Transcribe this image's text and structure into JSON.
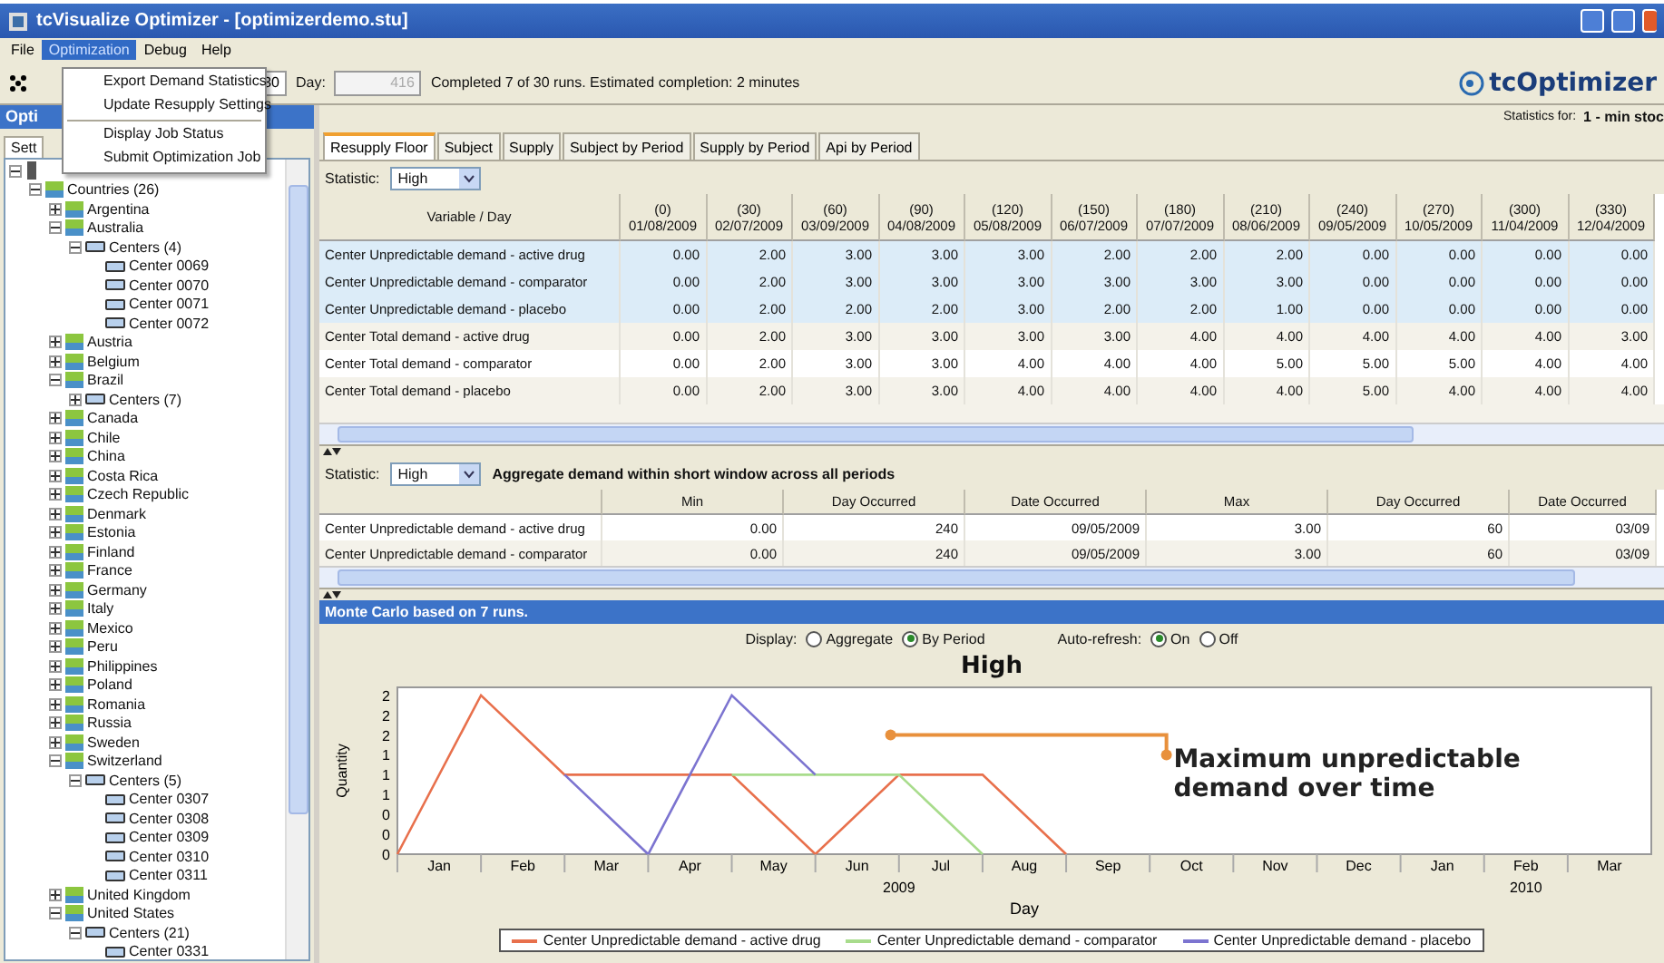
{
  "window": {
    "title": "tcVisualize Optimizer - [optimizerdemo.stu]"
  },
  "menu": [
    {
      "label": "File",
      "selected": false
    },
    {
      "label": "Optimization",
      "selected": true
    },
    {
      "label": "Debug",
      "selected": false
    },
    {
      "label": "Help",
      "selected": false
    }
  ],
  "open_menu": {
    "groups": [
      [
        "Export Demand Statistics",
        "Update Resupply Settings"
      ],
      [
        "Display Job Status",
        "Submit Optimization Job"
      ]
    ]
  },
  "toolbar": {
    "runs": "30",
    "day_label": "Day:",
    "day": "416",
    "day_disabled": true,
    "status": "Completed 7 of 30 runs.  Estimated completion: 2 minutes",
    "logo": "tcOptimizer"
  },
  "left_panel": {
    "title": "Opti",
    "tab": "Sett",
    "tree": [
      {
        "label": "Countries (26)",
        "kind": "group",
        "expanded": true,
        "children": [
          {
            "label": "Argentina",
            "kind": "country",
            "expanded": false
          },
          {
            "label": "Australia",
            "kind": "country",
            "expanded": true,
            "children": [
              {
                "label": "Centers (4)",
                "kind": "centers",
                "expanded": true,
                "children": [
                  {
                    "label": "Center 0069",
                    "kind": "center"
                  },
                  {
                    "label": "Center 0070",
                    "kind": "center"
                  },
                  {
                    "label": "Center 0071",
                    "kind": "center"
                  },
                  {
                    "label": "Center 0072",
                    "kind": "center"
                  }
                ]
              }
            ]
          },
          {
            "label": "Austria",
            "kind": "country",
            "expanded": false
          },
          {
            "label": "Belgium",
            "kind": "country",
            "expanded": false
          },
          {
            "label": "Brazil",
            "kind": "country",
            "expanded": true,
            "children": [
              {
                "label": "Centers (7)",
                "kind": "centers",
                "expanded": false
              }
            ]
          },
          {
            "label": "Canada",
            "kind": "country",
            "expanded": false
          },
          {
            "label": "Chile",
            "kind": "country",
            "expanded": false
          },
          {
            "label": "China",
            "kind": "country",
            "expanded": false
          },
          {
            "label": "Costa Rica",
            "kind": "country",
            "expanded": false
          },
          {
            "label": "Czech Republic",
            "kind": "country",
            "expanded": false
          },
          {
            "label": "Denmark",
            "kind": "country",
            "expanded": false
          },
          {
            "label": "Estonia",
            "kind": "country",
            "expanded": false
          },
          {
            "label": "Finland",
            "kind": "country",
            "expanded": false
          },
          {
            "label": "France",
            "kind": "country",
            "expanded": false
          },
          {
            "label": "Germany",
            "kind": "country",
            "expanded": false
          },
          {
            "label": "Italy",
            "kind": "country",
            "expanded": false
          },
          {
            "label": "Mexico",
            "kind": "country",
            "expanded": false
          },
          {
            "label": "Peru",
            "kind": "country",
            "expanded": false
          },
          {
            "label": "Philippines",
            "kind": "country",
            "expanded": false
          },
          {
            "label": "Poland",
            "kind": "country",
            "expanded": false
          },
          {
            "label": "Romania",
            "kind": "country",
            "expanded": false
          },
          {
            "label": "Russia",
            "kind": "country",
            "expanded": false
          },
          {
            "label": "Sweden",
            "kind": "country",
            "expanded": false
          },
          {
            "label": "Switzerland",
            "kind": "country",
            "expanded": true,
            "children": [
              {
                "label": "Centers (5)",
                "kind": "centers",
                "expanded": true,
                "children": [
                  {
                    "label": "Center 0307",
                    "kind": "center"
                  },
                  {
                    "label": "Center 0308",
                    "kind": "center"
                  },
                  {
                    "label": "Center 0309",
                    "kind": "center"
                  },
                  {
                    "label": "Center 0310",
                    "kind": "center"
                  },
                  {
                    "label": "Center 0311",
                    "kind": "center"
                  }
                ]
              }
            ]
          },
          {
            "label": "United Kingdom",
            "kind": "country",
            "expanded": false
          },
          {
            "label": "United States",
            "kind": "country",
            "expanded": true,
            "children": [
              {
                "label": "Centers (21)",
                "kind": "centers",
                "expanded": true,
                "children": [
                  {
                    "label": "Center 0331",
                    "kind": "center"
                  }
                ]
              }
            ]
          }
        ]
      }
    ]
  },
  "statistics_for": {
    "label": "Statistics for:",
    "value": "1 - min stoc"
  },
  "tabs": [
    {
      "label": "Resupply Floor",
      "selected": true
    },
    {
      "label": "Subject",
      "selected": false
    },
    {
      "label": "Supply",
      "selected": false
    },
    {
      "label": "Subject by Period",
      "selected": false
    },
    {
      "label": "Supply by Period",
      "selected": false
    },
    {
      "label": "Api by Period",
      "selected": false
    }
  ],
  "period_table": {
    "statistic_label": "Statistic:",
    "statistic": "High",
    "columns": [
      {
        "day": "Variable / Day"
      },
      {
        "day": "(0)",
        "date": "01/08/2009"
      },
      {
        "day": "(30)",
        "date": "02/07/2009"
      },
      {
        "day": "(60)",
        "date": "03/09/2009"
      },
      {
        "day": "(90)",
        "date": "04/08/2009"
      },
      {
        "day": "(120)",
        "date": "05/08/2009"
      },
      {
        "day": "(150)",
        "date": "06/07/2009"
      },
      {
        "day": "(180)",
        "date": "07/07/2009"
      },
      {
        "day": "(210)",
        "date": "08/06/2009"
      },
      {
        "day": "(240)",
        "date": "09/05/2009"
      },
      {
        "day": "(270)",
        "date": "10/05/2009"
      },
      {
        "day": "(300)",
        "date": "11/04/2009"
      },
      {
        "day": "(330)",
        "date": "12/04/2009"
      }
    ],
    "rows": [
      {
        "selected": true,
        "cells": [
          "Center Unpredictable demand - active drug",
          "0.00",
          "2.00",
          "3.00",
          "3.00",
          "3.00",
          "2.00",
          "2.00",
          "2.00",
          "0.00",
          "0.00",
          "0.00",
          "0.00"
        ]
      },
      {
        "selected": true,
        "cells": [
          "Center Unpredictable demand - comparator",
          "0.00",
          "2.00",
          "3.00",
          "3.00",
          "3.00",
          "3.00",
          "3.00",
          "3.00",
          "0.00",
          "0.00",
          "0.00",
          "0.00"
        ]
      },
      {
        "selected": true,
        "cells": [
          "Center Unpredictable demand - placebo",
          "0.00",
          "2.00",
          "2.00",
          "2.00",
          "3.00",
          "2.00",
          "2.00",
          "1.00",
          "0.00",
          "0.00",
          "0.00",
          "0.00"
        ]
      },
      {
        "selected": false,
        "cells": [
          "Center Total demand - active drug",
          "0.00",
          "2.00",
          "3.00",
          "3.00",
          "3.00",
          "3.00",
          "4.00",
          "4.00",
          "4.00",
          "4.00",
          "4.00",
          "3.00"
        ]
      },
      {
        "selected": false,
        "cells": [
          "Center Total demand - comparator",
          "0.00",
          "2.00",
          "3.00",
          "3.00",
          "4.00",
          "4.00",
          "4.00",
          "5.00",
          "5.00",
          "5.00",
          "4.00",
          "4.00"
        ]
      },
      {
        "selected": false,
        "cells": [
          "Center Total demand - placebo",
          "0.00",
          "2.00",
          "3.00",
          "3.00",
          "4.00",
          "4.00",
          "4.00",
          "4.00",
          "5.00",
          "4.00",
          "4.00",
          "4.00"
        ]
      }
    ]
  },
  "aggregate_table": {
    "statistic_label": "Statistic:",
    "statistic": "High",
    "caption": "Aggregate demand within short window across all periods",
    "columns": [
      "Min",
      "Day Occurred",
      "Date Occurred",
      "Max",
      "Day Occurred",
      "Date Occurred"
    ],
    "rows": [
      [
        "Center Unpredictable demand - active drug",
        "0.00",
        "240",
        "09/05/2009",
        "3.00",
        "60",
        "03/09"
      ],
      [
        "Center Unpredictable demand - comparator",
        "0.00",
        "240",
        "09/05/2009",
        "3.00",
        "60",
        "03/09"
      ]
    ]
  },
  "monte_carlo": {
    "title": "Monte Carlo based on 7 runs.",
    "display_label": "Display:",
    "display": [
      {
        "label": "Aggregate",
        "selected": false
      },
      {
        "label": "By Period",
        "selected": true
      }
    ],
    "refresh_label": "Auto-refresh:",
    "refresh": [
      {
        "label": "On",
        "selected": true
      },
      {
        "label": "Off",
        "selected": false
      }
    ],
    "callout": "Maximum unpredictable demand over time",
    "chart": {
      "title": "High",
      "ylabel": "Quantity",
      "y_tick_labels": [
        "2",
        "2",
        "2",
        "1",
        "1",
        "1",
        "0",
        "0",
        "0"
      ],
      "months": [
        "Jan",
        "Feb",
        "Mar",
        "Apr",
        "May",
        "Jun",
        "Jul",
        "Aug",
        "Sep",
        "Oct",
        "Nov",
        "Dec",
        "Jan",
        "Feb",
        "Mar"
      ],
      "year_labels": [
        "2009",
        "2010"
      ],
      "xlabel": "Day",
      "legend": [
        {
          "name": "Center Unpredictable demand - active drug",
          "color": "#e8704c"
        },
        {
          "name": "Center Unpredictable demand - comparator",
          "color": "#a8dc8c"
        },
        {
          "name": "Center Unpredictable demand - placebo",
          "color": "#7c74d0"
        }
      ]
    }
  }
}
